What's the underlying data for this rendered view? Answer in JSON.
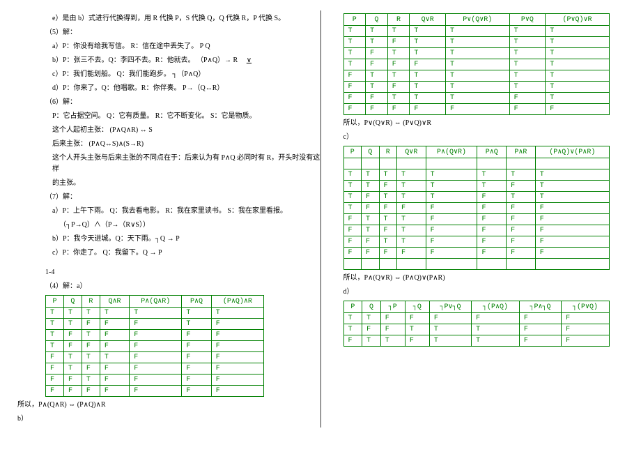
{
  "left": {
    "l1": "e）是由 b）式进行代换得到，用 R 代换 P，S 代换 Q，Q 代换 R，P 代换 S。",
    "l2": "（5）解：",
    "l3": "a）P：你没有给我写信。 R：信在途中丢失了。 P  Q",
    "l4": "b）P：张三不去。Q：李四不去。R：他就去。  （P∧Q）→ R",
    "l4b": "∨",
    "l5": "c）P：我们能划船。 Q：我们能跑步。 ┐（P∧Q）",
    "l6": "d）P：你来了。Q：他唱歌。R：你伴奏。 P→（Q↔R）",
    "l7": "（6）解：",
    "l8": "P：它占据空间。 Q：它有质量。 R：它不断变化。 S：它是物质。",
    "l9": "这个人起初主张： (P∧Q∧R) ↔ S",
    "l10": "后来主张： (P∧Q↔S)∧(S→R)",
    "l11": "这个人开头主张与后来主张的不同点在于：后来认为有 P∧Q 必同时有 R，开头时没有这样",
    "l11b": "的主张。",
    "l12": "（7）解：",
    "l13": "a）P：上午下雨。 Q：我去看电影。 R：我在家里读书。 S：我在家里看报。",
    "l14": "（┐P→Q）∧（P→（R∨S））",
    "l15": "b）P：我今天进城。Q：天下雨。┐Q → P",
    "l16": "c）P：你走了。 Q：我留下。Q → P",
    "l17": "1-4",
    "l18": "（4）解：a）",
    "l19": "所以，P∧(Q∧R) ⇔ (P∧Q)∧R",
    "l20": "b）"
  },
  "tableA": {
    "head": [
      "P",
      "Q",
      "R",
      "Q∧R",
      "P∧(Q∧R)",
      "P∧Q",
      "(P∧Q)∧R"
    ],
    "rows": [
      [
        "T",
        "T",
        "T",
        "T",
        "T",
        "T",
        "T"
      ],
      [
        "T",
        "T",
        "F",
        "F",
        "F",
        "T",
        "F"
      ],
      [
        "T",
        "F",
        "T",
        "F",
        "F",
        "F",
        "F"
      ],
      [
        "T",
        "F",
        "F",
        "F",
        "F",
        "F",
        "F"
      ],
      [
        "F",
        "T",
        "T",
        "T",
        "F",
        "F",
        "F"
      ],
      [
        "F",
        "T",
        "F",
        "F",
        "F",
        "F",
        "F"
      ],
      [
        "F",
        "F",
        "T",
        "F",
        "F",
        "F",
        "F"
      ],
      [
        "F",
        "F",
        "F",
        "F",
        "F",
        "F",
        "F"
      ]
    ]
  },
  "right": {
    "r1concl": "所以，P∨(Q∨R) ⇔ (P∨Q)∨R",
    "r1c": "c）",
    "r2concl": "所以，P∧(Q∨R) ⇔ (P∧Q)∨(P∧R)",
    "r2d": "d）"
  },
  "tableR1": {
    "head": [
      "P",
      "Q",
      "R",
      "Q∨R",
      "P∨(Q∨R)",
      "P∨Q",
      "(P∨Q)∨R"
    ],
    "rows": [
      [
        "T",
        "T",
        "T",
        "T",
        "T",
        "T",
        "T"
      ],
      [
        "T",
        "T",
        "F",
        "T",
        "T",
        "T",
        "T"
      ],
      [
        "T",
        "F",
        "T",
        "T",
        "T",
        "T",
        "T"
      ],
      [
        "T",
        "F",
        "F",
        "F",
        "T",
        "T",
        "T"
      ],
      [
        "F",
        "T",
        "T",
        "T",
        "T",
        "T",
        "T"
      ],
      [
        "F",
        "T",
        "F",
        "T",
        "T",
        "T",
        "T"
      ],
      [
        "F",
        "F",
        "T",
        "T",
        "T",
        "F",
        "T"
      ],
      [
        "F",
        "F",
        "F",
        "F",
        "F",
        "F",
        "F"
      ]
    ]
  },
  "tableR2": {
    "head": [
      "P",
      "Q",
      "R",
      "Q∨R",
      "P∧(Q∨R)",
      "P∧Q",
      "P∧R",
      "(P∧Q)∨(P∧R)"
    ],
    "rows": [
      [
        "T",
        "T",
        "T",
        "T",
        "T",
        "T",
        "T",
        "T"
      ],
      [
        "T",
        "T",
        "F",
        "T",
        "T",
        "T",
        "F",
        "T"
      ],
      [
        "T",
        "F",
        "T",
        "T",
        "T",
        "F",
        "T",
        "T"
      ],
      [
        "T",
        "F",
        "F",
        "F",
        "F",
        "F",
        "F",
        "F"
      ],
      [
        "F",
        "T",
        "T",
        "T",
        "F",
        "F",
        "F",
        "F"
      ],
      [
        "F",
        "T",
        "F",
        "T",
        "F",
        "F",
        "F",
        "F"
      ],
      [
        "F",
        "F",
        "T",
        "T",
        "F",
        "F",
        "F",
        "F"
      ],
      [
        "F",
        "F",
        "F",
        "F",
        "F",
        "F",
        "F",
        "F"
      ]
    ]
  },
  "tableR3": {
    "head": [
      "P",
      "Q",
      "┐P",
      "┐Q",
      "┐P∨┐Q",
      "┐(P∧Q)",
      "┐P∧┐Q",
      "┐(P∨Q)"
    ],
    "rows": [
      [
        "T",
        "T",
        "F",
        "F",
        "F",
        "F",
        "F",
        "F"
      ],
      [
        "T",
        "F",
        "F",
        "T",
        "T",
        "T",
        "F",
        "F"
      ],
      [
        "F",
        "T",
        "T",
        "F",
        "T",
        "T",
        "F",
        "F"
      ]
    ]
  }
}
